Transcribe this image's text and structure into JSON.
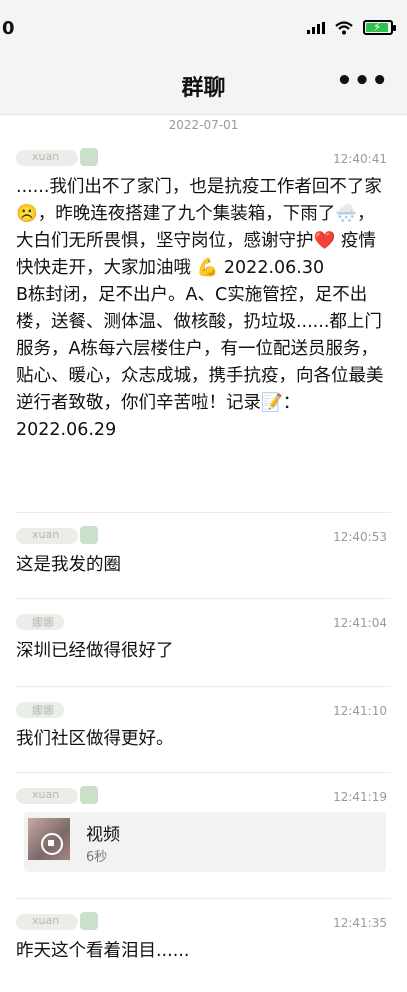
{
  "status": {
    "time": "0"
  },
  "header": {
    "title": "群聊",
    "more_label": "•••"
  },
  "date_divider": "2022-07-01",
  "messages": [
    {
      "sender": "xuan",
      "time": "12:40:41",
      "text": "......我们出不了家门，也是抗疫工作者回不了家☹️，昨晚连夜搭建了九个集装箱，下雨了🌨️，大白们无所畏惧，坚守岗位，感谢守护❤️ 疫情快快走开，大家加油哦 💪 2022.06.30\nB栋封闭，足不出户。A、C实施管控，足不出楼，送餐、测体温、做核酸，扔垃圾......都上门服务，A栋每六层楼住户，有一位配送员服务，贴心、暖心，众志成城，携手抗疫，向各位最美逆行者致敬，你们辛苦啦！记录📝：2022.06.29"
    },
    {
      "sender": "xuan",
      "time": "12:40:53",
      "text": "这是我发的圈"
    },
    {
      "sender": "娜娜",
      "time": "12:41:04",
      "text": "深圳已经做得很好了"
    },
    {
      "sender": "娜娜",
      "time": "12:41:10",
      "text": "我们社区做得更好。"
    },
    {
      "sender": "xuan",
      "time": "12:41:19",
      "video": {
        "title": "视频",
        "duration": "6秒"
      }
    },
    {
      "sender": "xuan",
      "time": "12:41:35",
      "text": "昨天这个看着泪目......"
    }
  ]
}
